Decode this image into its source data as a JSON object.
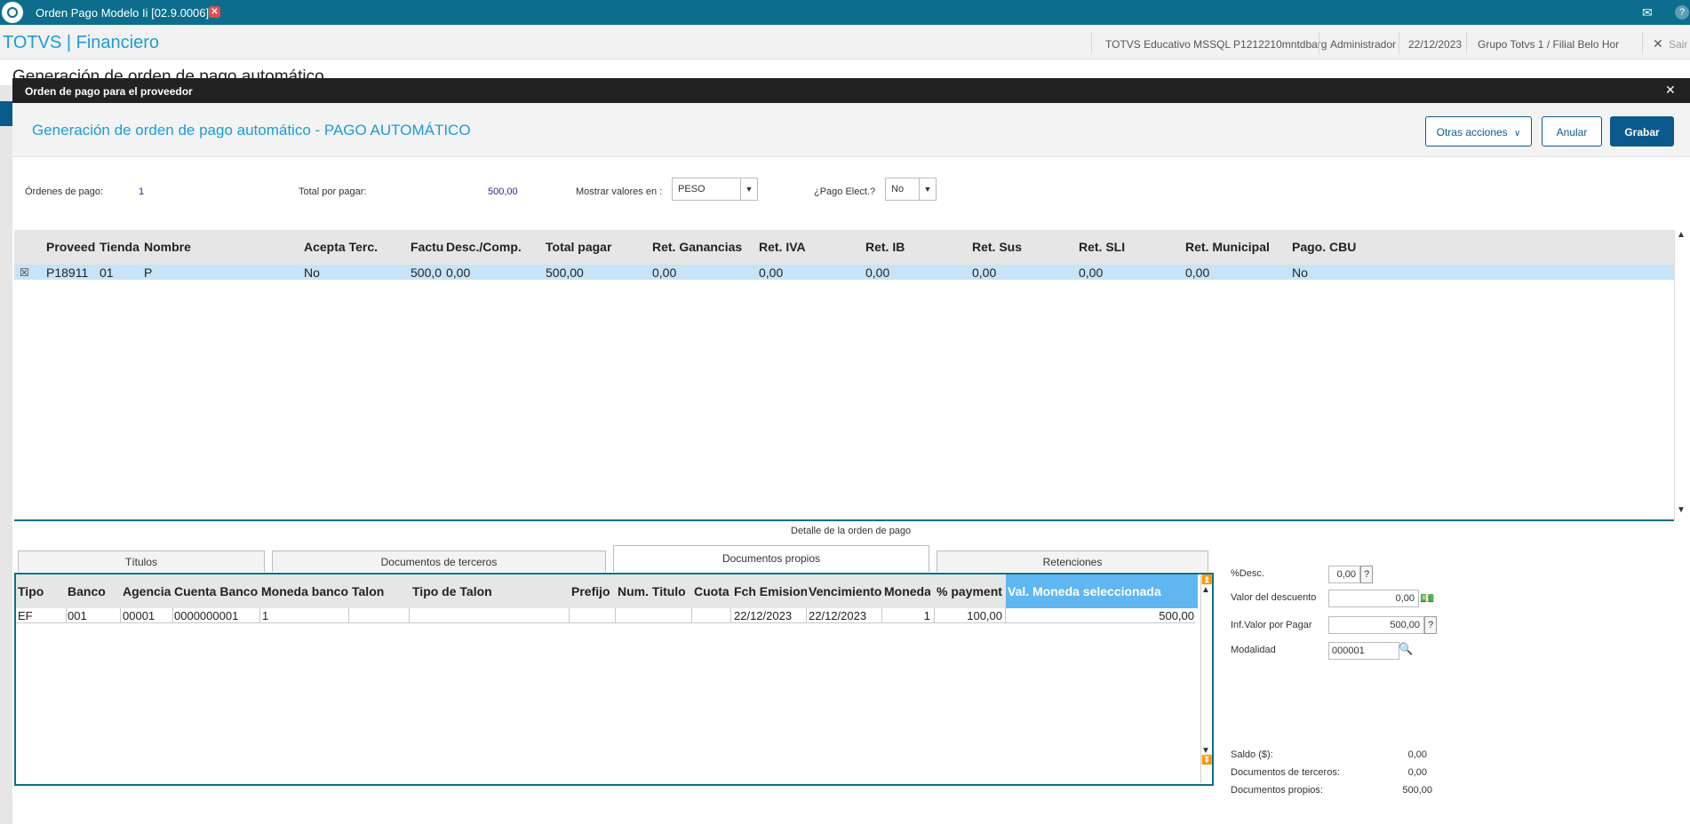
{
  "topbar": {
    "title": "Orden Pago Modelo Ii [02.9.0006]",
    "close": "✕"
  },
  "header": {
    "brand": "TOTVS | Financiero",
    "env": "TOTVS Educativo MSSQL P1212210mntdbarg",
    "user": "Administrador",
    "date": "22/12/2023",
    "branch": "Grupo Totvs 1 / Filial Belo Hor",
    "exit": "Sair"
  },
  "background": {
    "title": "Generación de orden de pago automático"
  },
  "dialog": {
    "title": "Orden de pago para el proveedor",
    "page_title": "Generación de orden de pago automático - PAGO AUTOMÁTICO",
    "buttons": {
      "otras": "Otras acciones",
      "anular": "Anular",
      "grabar": "Grabar"
    }
  },
  "summary": {
    "ordenes_label": "Órdenes de pago:",
    "ordenes_value": "1",
    "total_label": "Total por pagar:",
    "total_value": "500,00",
    "mostrar_label": "Mostrar valores en :",
    "mostrar_value": "PESO",
    "pago_label": "¿Pago Elect.?",
    "pago_value": "No"
  },
  "grid1": {
    "headers": [
      "Proveed",
      "Tienda",
      "Nombre",
      "Acepta Terc.",
      "Factu",
      "Desc./Comp.",
      "Total pagar",
      "Ret. Ganancias",
      "Ret. IVA",
      "Ret. IB",
      "Ret. Sus",
      "Ret. SLI",
      "Ret. Municipal",
      "Pago. CBU"
    ],
    "row": [
      "P18911",
      "01",
      "P",
      "No",
      "500,0",
      "0,00",
      "500,00",
      "0,00",
      "0,00",
      "0,00",
      "0,00",
      "0,00",
      "0,00",
      "No"
    ]
  },
  "detail": {
    "caption": "Detalle de la orden de pago",
    "tabs": [
      "Títulos",
      "Documentos de terceros",
      "Documentos propios",
      "Retenciones"
    ]
  },
  "grid2": {
    "headers": [
      "Tipo",
      "Banco",
      "Agencia",
      "Cuenta Banco",
      "Moneda banco",
      "Talon",
      "Tipo de Talon",
      "Prefijo",
      "Num. Titulo",
      "Cuota",
      "Fch Emision",
      "Vencimiento",
      "Moneda",
      "% payment",
      "Val. Moneda seleccionada"
    ],
    "row": [
      "EF",
      "001",
      "00001",
      "0000000001",
      "1",
      "",
      "",
      "",
      "",
      "",
      "22/12/2023",
      "22/12/2023",
      "1",
      "100,00",
      "500,00"
    ]
  },
  "side": {
    "desc_label": "%Desc.",
    "desc_value": "0,00",
    "valdesc_label": "Valor del descuento",
    "valdesc_value": "0,00",
    "infval_label": "Inf.Valor por Pagar",
    "infval_value": "500,00",
    "modalidad_label": "Modalidad",
    "modalidad_value": "000001",
    "saldo_label": "Saldo ($):",
    "saldo_value": "0,00",
    "terceros_label": "Documentos de terceros:",
    "terceros_value": "0,00",
    "propios_label": "Documentos propios:",
    "propios_value": "500,00",
    "help": "?"
  }
}
